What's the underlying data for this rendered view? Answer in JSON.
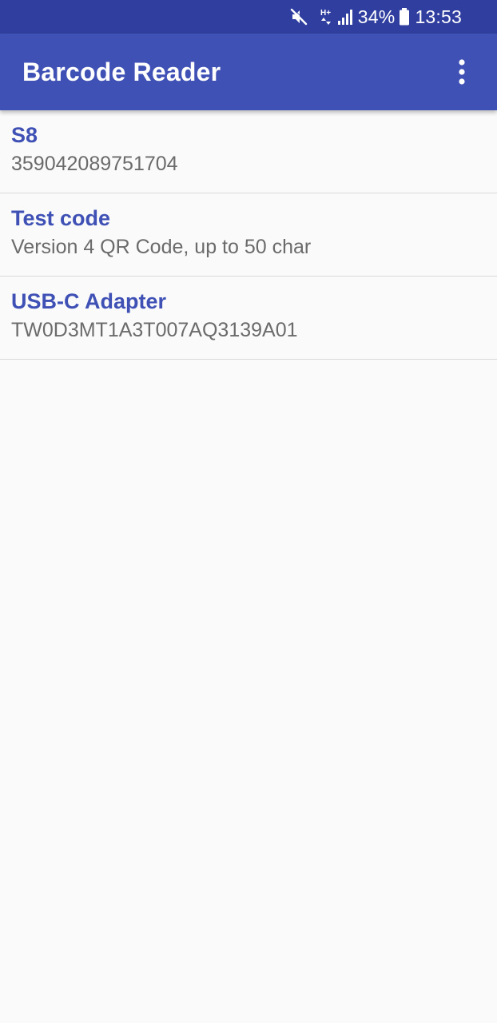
{
  "status_bar": {
    "network_type": "H+",
    "battery_percent": "34%",
    "time": "13:53"
  },
  "app_bar": {
    "title": "Barcode Reader",
    "menu_icon": "more-vert-icon"
  },
  "items": [
    {
      "title": "S8",
      "value": "359042089751704"
    },
    {
      "title": "Test code",
      "value": "Version 4 QR Code, up to 50 char"
    },
    {
      "title": "USB-C Adapter",
      "value": "TW0D3MT1A3T007AQ3139A01"
    }
  ],
  "colors": {
    "status_bar": "#303f9f",
    "app_bar": "#3f51b5",
    "item_title": "#3f51b5",
    "item_value": "#6b6b6b",
    "background": "#fafafa",
    "divider": "#d9d9d9"
  }
}
